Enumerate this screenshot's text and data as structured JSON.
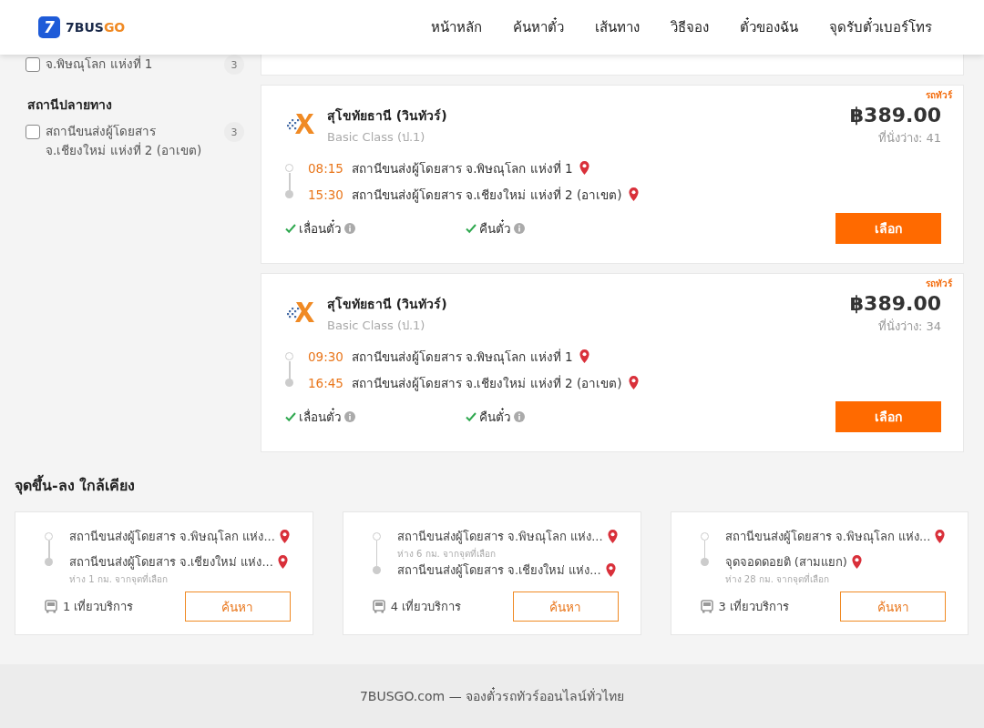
{
  "header": {
    "logo": {
      "badge": "7",
      "text_a": "7BUS",
      "text_b": "GO"
    },
    "nav": [
      "หน้าหลัก",
      "ค้นหาตั๋ว",
      "เส้นทาง",
      "วิธีจอง",
      "ตั๋วของฉัน",
      "จุดรับตั๋วเบอร์โทร"
    ]
  },
  "sidebar": {
    "origin_items": [
      {
        "label": "จ.พิษณุโลก แห่งที่ 1",
        "count": "3",
        "checked": false
      }
    ],
    "destination": {
      "title": "สถานีปลายทาง",
      "items": [
        {
          "label": "สถานีขนส่งผู้โดยสาร จ.เชียงใหม่ แห่งที่ 2 (อาเขต)",
          "count": "3",
          "checked": false
        }
      ]
    }
  },
  "trips": [
    {
      "tag": "รถทัวร์",
      "operator": "สุโขทัยธานี (วินทัวร์)",
      "bus_class": "Basic Class (ป.1)",
      "price": "฿389.00",
      "seats": "ที่นั่งว่าง: 41",
      "stops": [
        {
          "time": "08:15",
          "name": "สถานีขนส่งผู้โดยสาร จ.พิษณุโลก แห่งที่ 1"
        },
        {
          "time": "15:30",
          "name": "สถานีขนส่งผู้โดยสาร จ.เชียงใหม่ แห่งที่ 2 (อาเขต)"
        }
      ],
      "features": [
        {
          "label": "เลื่อนตั๋ว",
          "available": true
        },
        {
          "label": "คืนตั๋ว",
          "available": true
        }
      ],
      "button": "เลือก"
    },
    {
      "tag": "รถทัวร์",
      "operator": "สุโขทัยธานี (วินทัวร์)",
      "bus_class": "Basic Class (ป.1)",
      "price": "฿389.00",
      "seats": "ที่นั่งว่าง: 34",
      "stops": [
        {
          "time": "09:30",
          "name": "สถานีขนส่งผู้โดยสาร จ.พิษณุโลก แห่งที่ 1"
        },
        {
          "time": "16:45",
          "name": "สถานีขนส่งผู้โดยสาร จ.เชียงใหม่ แห่งที่ 2 (อาเขต)"
        }
      ],
      "features": [
        {
          "label": "เลื่อนตั๋ว",
          "available": true
        },
        {
          "label": "คืนตั๋ว",
          "available": true
        }
      ],
      "button": "เลือก"
    }
  ],
  "nearby": {
    "title": "จุดขึ้น-ลง ใกล้เคียง",
    "cards": [
      {
        "stops": [
          {
            "name": "สถานีขนส่งผู้โดยสาร จ.พิษณุโลก แห่ง..."
          },
          {
            "name": "สถานีขนส่งผู้โดยสาร จ.เชียงใหม่ แห่ง...",
            "note": "ห่าง 1 กม. จากจุดที่เลือก"
          }
        ],
        "trips": "1 เที่ยวบริการ",
        "button": "ค้นหา"
      },
      {
        "stops": [
          {
            "name": "สถานีขนส่งผู้โดยสาร จ.พิษณุโลก แห่ง...",
            "note": "ห่าง 6 กม. จากจุดที่เลือก"
          },
          {
            "name": "สถานีขนส่งผู้โดยสาร จ.เชียงใหม่ แห่ง..."
          }
        ],
        "trips": "4 เที่ยวบริการ",
        "button": "ค้นหา"
      },
      {
        "stops": [
          {
            "name": "สถานีขนส่งผู้โดยสาร จ.พิษณุโลก แห่ง..."
          },
          {
            "name": "จุดจอดดอยติ (สามแยก)",
            "note": "ห่าง 28 กม. จากจุดที่เลือก"
          }
        ],
        "trips": "3 เที่ยวบริการ",
        "button": "ค้นหา"
      }
    ]
  },
  "footer": "7BUSGO.com — จองตั๋วรถทัวร์ออนไลน์ทั่วไทย"
}
